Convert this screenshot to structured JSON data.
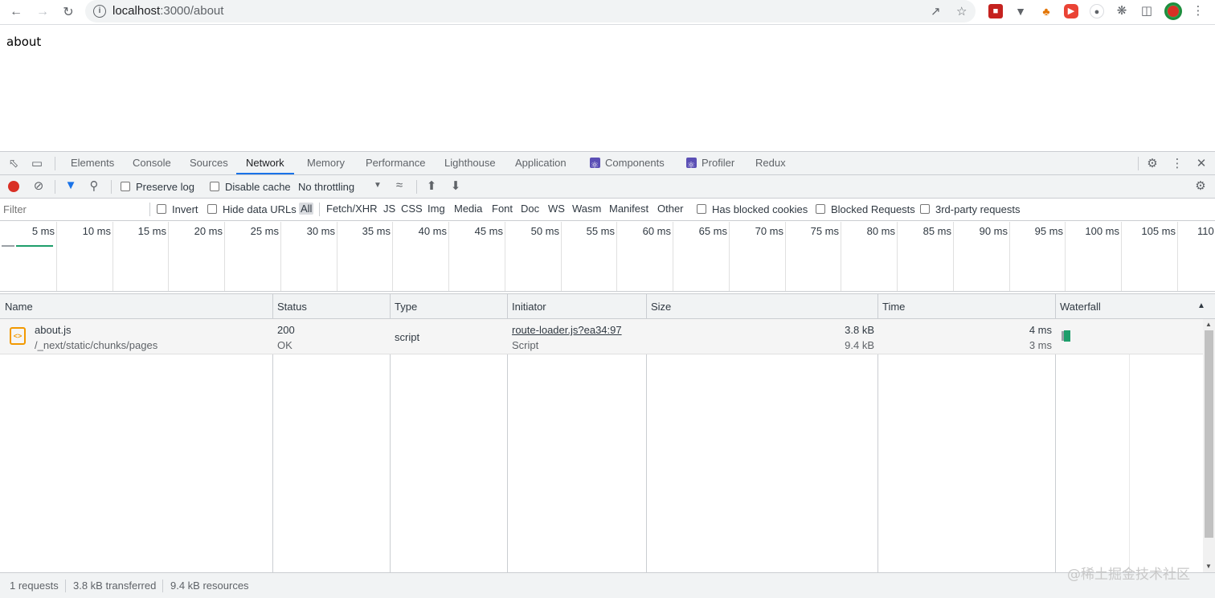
{
  "browser": {
    "url_host": "localhost",
    "url_path": ":3000/about"
  },
  "page": {
    "text": "about"
  },
  "devtools": {
    "tabs": [
      "Elements",
      "Console",
      "Sources",
      "Network",
      "Memory",
      "Performance",
      "Lighthouse",
      "Application",
      "Components",
      "Profiler",
      "Redux"
    ],
    "active_tab": "Network",
    "toolbar": {
      "preserve_log": "Preserve log",
      "disable_cache": "Disable cache",
      "throttling": "No throttling"
    },
    "filter_bar": {
      "filter_placeholder": "Filter",
      "invert": "Invert",
      "hide_data_urls": "Hide data URLs",
      "types": [
        "All",
        "Fetch/XHR",
        "JS",
        "CSS",
        "Img",
        "Media",
        "Font",
        "Doc",
        "WS",
        "Wasm",
        "Manifest",
        "Other"
      ],
      "selected_type": "All",
      "has_blocked_cookies": "Has blocked cookies",
      "blocked_requests": "Blocked Requests",
      "third_party": "3rd-party requests"
    },
    "overview_ticks": [
      "5 ms",
      "10 ms",
      "15 ms",
      "20 ms",
      "25 ms",
      "30 ms",
      "35 ms",
      "40 ms",
      "45 ms",
      "50 ms",
      "55 ms",
      "60 ms",
      "65 ms",
      "70 ms",
      "75 ms",
      "80 ms",
      "85 ms",
      "90 ms",
      "95 ms",
      "100 ms",
      "105 ms",
      "110"
    ],
    "columns": [
      "Name",
      "Status",
      "Type",
      "Initiator",
      "Size",
      "Time",
      "Waterfall"
    ],
    "requests": [
      {
        "name": "about.js",
        "path": "/_next/static/chunks/pages",
        "status_code": "200",
        "status_text": "OK",
        "type": "script",
        "initiator": "route-loader.js?ea34:97",
        "initiator_type": "Script",
        "size_transferred": "3.8 kB",
        "size_resource": "9.4 kB",
        "time_total": "4 ms",
        "time_latency": "3 ms"
      }
    ],
    "status": {
      "requests": "1 requests",
      "transferred": "3.8 kB transferred",
      "resources": "9.4 kB resources"
    }
  },
  "watermark": "@稀土掘金技术社区",
  "colors": {
    "accent": "#1a73e8",
    "record": "#d93025",
    "waterfall_bar": "#1e9e6b"
  }
}
